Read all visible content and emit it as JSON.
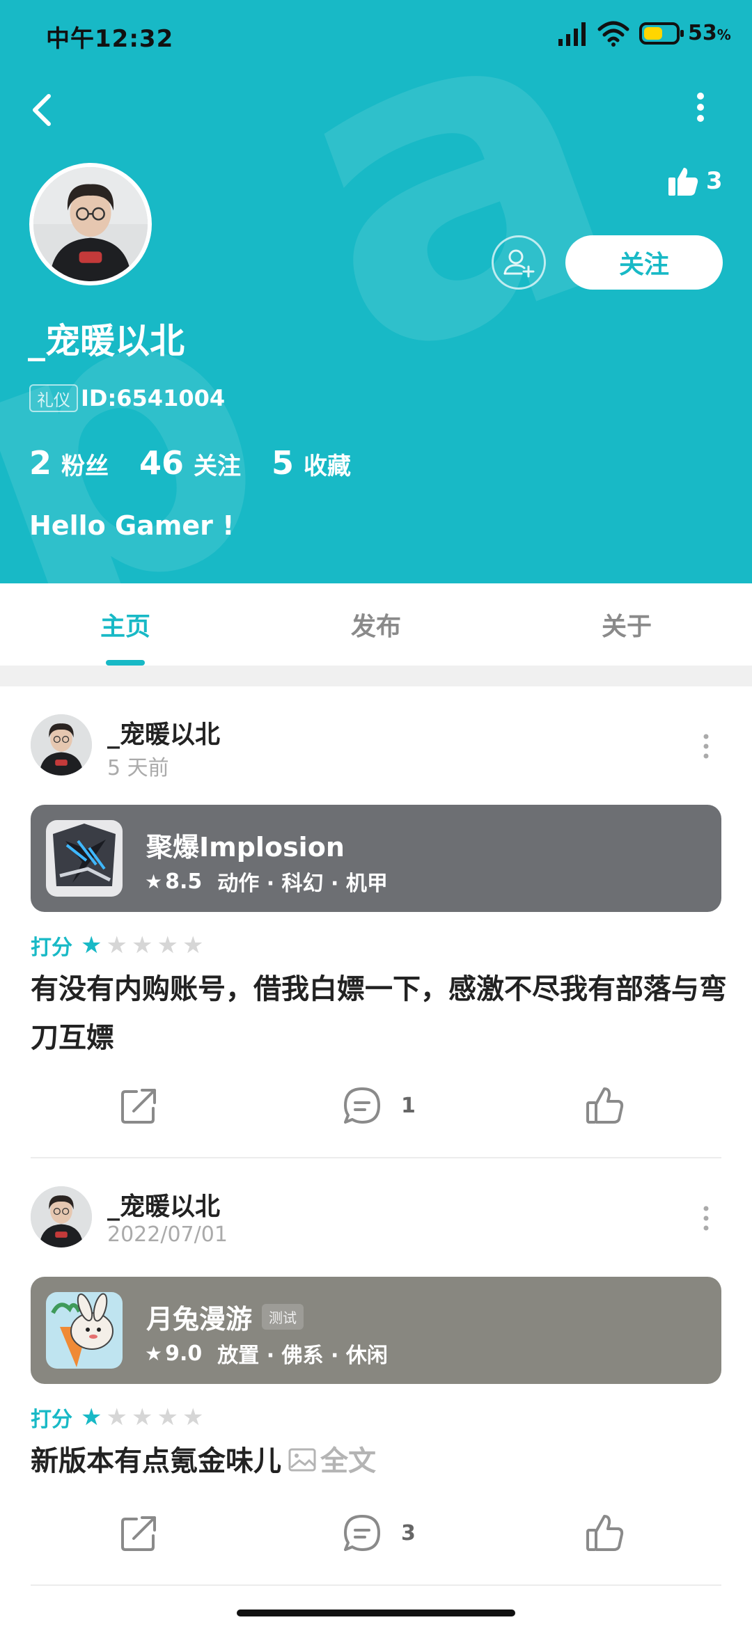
{
  "status_bar": {
    "time": "中午12:32",
    "battery_pct": "53",
    "battery_unit": "%"
  },
  "header": {
    "likes_count": "3",
    "follow_label": "关注",
    "username": "_宠暖以北",
    "badge": "礼仪",
    "user_id": "ID:6541004",
    "stats": [
      {
        "value": "2",
        "label": "粉丝"
      },
      {
        "value": "46",
        "label": "关注"
      },
      {
        "value": "5",
        "label": "收藏"
      }
    ],
    "bio": "Hello Gamer !",
    "accent_color": "#18b9c6"
  },
  "tabs": [
    {
      "label": "主页",
      "active": true
    },
    {
      "label": "发布",
      "active": false
    },
    {
      "label": "关于",
      "active": false
    }
  ],
  "posts": [
    {
      "author": "_宠暖以北",
      "time": "5 天前",
      "game": {
        "name": "聚爆Implosion",
        "tag": "",
        "score": "8.5",
        "genres": "动作 · 科幻 · 机甲",
        "card_color": "#6d6f73"
      },
      "rating_label": "打分",
      "rating": 1,
      "rating_max": 5,
      "text": "有没有内购账号，借我白嫖一下，感激不尽我有部落与弯刀互嫖",
      "comments": "1"
    },
    {
      "author": "_宠暖以北",
      "time": "2022/07/01",
      "game": {
        "name": "月兔漫游",
        "tag": "测试",
        "score": "9.0",
        "genres": "放置 · 佛系 · 休闲",
        "card_color": "#888780"
      },
      "rating_label": "打分",
      "rating": 1,
      "rating_max": 5,
      "text": "新版本有点氪金味儿",
      "fulltext_label": "全文",
      "comments": "3"
    }
  ]
}
